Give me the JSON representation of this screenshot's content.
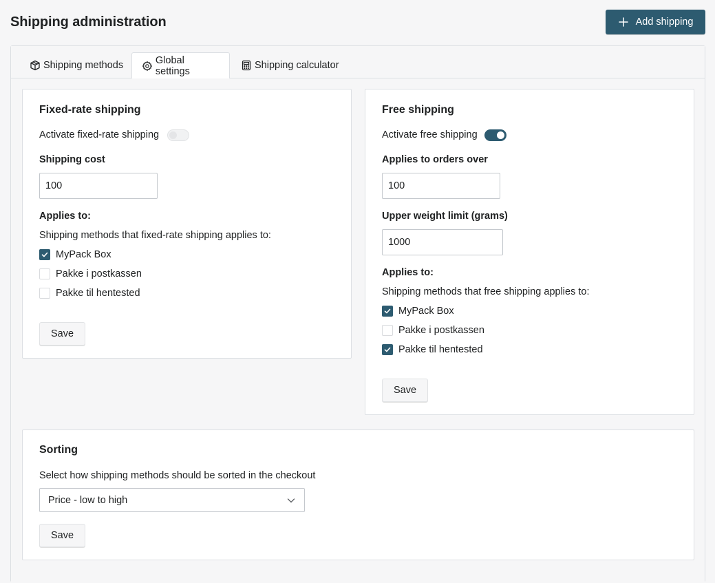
{
  "header": {
    "title": "Shipping administration",
    "add_button_label": "Add shipping"
  },
  "tabs": [
    {
      "label": "Shipping methods",
      "icon": "package-icon",
      "active": false
    },
    {
      "label": "Global settings",
      "icon": "gear-icon",
      "active": true
    },
    {
      "label": "Shipping calculator",
      "icon": "calculator-icon",
      "active": false
    }
  ],
  "fixed_rate": {
    "title": "Fixed-rate shipping",
    "activate_label": "Activate fixed-rate shipping",
    "activated": false,
    "cost_label": "Shipping cost",
    "cost_value": "100",
    "applies_heading": "Applies to:",
    "applies_desc": "Shipping methods that fixed-rate shipping applies to:",
    "methods": [
      {
        "label": "MyPack Box",
        "checked": true
      },
      {
        "label": "Pakke i postkassen",
        "checked": false
      },
      {
        "label": "Pakke til hentested",
        "checked": false
      }
    ],
    "save_label": "Save"
  },
  "free": {
    "title": "Free shipping",
    "activate_label": "Activate free shipping",
    "activated": true,
    "orders_over_label": "Applies to orders over",
    "orders_over_value": "100",
    "weight_label": "Upper weight limit (grams)",
    "weight_value": "1000",
    "applies_heading": "Applies to:",
    "applies_desc": "Shipping methods that free shipping applies to:",
    "methods": [
      {
        "label": "MyPack Box",
        "checked": true
      },
      {
        "label": "Pakke i postkassen",
        "checked": false
      },
      {
        "label": "Pakke til hentested",
        "checked": true
      }
    ],
    "save_label": "Save"
  },
  "sorting": {
    "title": "Sorting",
    "desc": "Select how shipping methods should be sorted in the checkout",
    "selected": "Price - low to high",
    "save_label": "Save"
  },
  "colors": {
    "primary": "#2d5b70",
    "background": "#f6f6f7",
    "border": "#dcdfe3"
  }
}
